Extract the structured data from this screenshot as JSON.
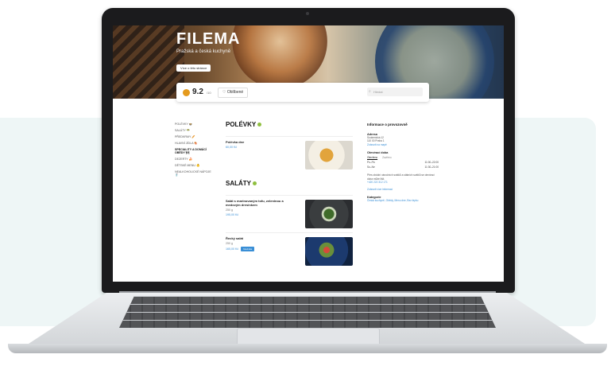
{
  "site": {
    "brand": "FILEMA",
    "tagline": "Pražská a česká kuchyně",
    "hero_button": "Více o této stránce"
  },
  "toolbar": {
    "rating": "9.2",
    "rating_suffix": "/10",
    "favorite_label": "Oblíbené",
    "search_placeholder": "Hledat"
  },
  "sidebar": {
    "items": [
      {
        "label": "POLÉVKY 🍲",
        "active": false
      },
      {
        "label": "SALÁTY 🥗",
        "active": false
      },
      {
        "label": "PŘEDKRMY 🥖",
        "active": false
      },
      {
        "label": "HLAVNÍ JÍDLA 🍖",
        "active": false
      },
      {
        "label": "SPECIALITY A DOMÁCÍ OBĚDY 🍽",
        "active": true
      },
      {
        "label": "DEZERTY 🍰",
        "active": false
      },
      {
        "label": "DĚTSKÉ MENU 👶",
        "active": false
      },
      {
        "label": "NEALKOHOLICKÉ NÁPOJE 🥤",
        "active": false
      }
    ]
  },
  "menu": {
    "sections": [
      {
        "title": "POLÉVKY",
        "dot_color": "#8fbf3f",
        "items": [
          {
            "name": "Polévka dne",
            "meta": "",
            "price": "60,00 Kč",
            "badge": ""
          }
        ]
      },
      {
        "title": "SALÁTY",
        "dot_color": "#8fbf3f",
        "items": [
          {
            "name": "Salát s marinovaným tofu, zeleninou a medovým dresinkem",
            "meta": "250 g",
            "price": "195,00 Kč",
            "badge": ""
          },
          {
            "name": "Řecký salát",
            "meta": "250 g",
            "price": "165,00 Kč",
            "badge": "Novinka"
          }
        ]
      }
    ]
  },
  "info": {
    "title": "Informace o provozovně",
    "address_heading": "Adresa",
    "address_lines": [
      "Soukenická 12",
      "110 00 Praha 1"
    ],
    "directions_link": "Zobrazit na mapě",
    "hours_heading": "Otevírací doba",
    "hours_tabs": [
      "Otevřeno",
      "Zavřeno"
    ],
    "hours": [
      {
        "day": "Po–Pá",
        "time": "11:00–22:00"
      },
      {
        "day": "So–Ne",
        "time": "11:30–21:00"
      }
    ],
    "note": "Přes období vánočních svátků a státních svátků se otevírací doba může lišit.",
    "phone_link": "+420 222 312 171",
    "more_link": "Zobrazit více informací",
    "category_heading": "Kategorie",
    "categories": "Česká kuchyně, Obědy, Menu dne, Bez lepku"
  }
}
